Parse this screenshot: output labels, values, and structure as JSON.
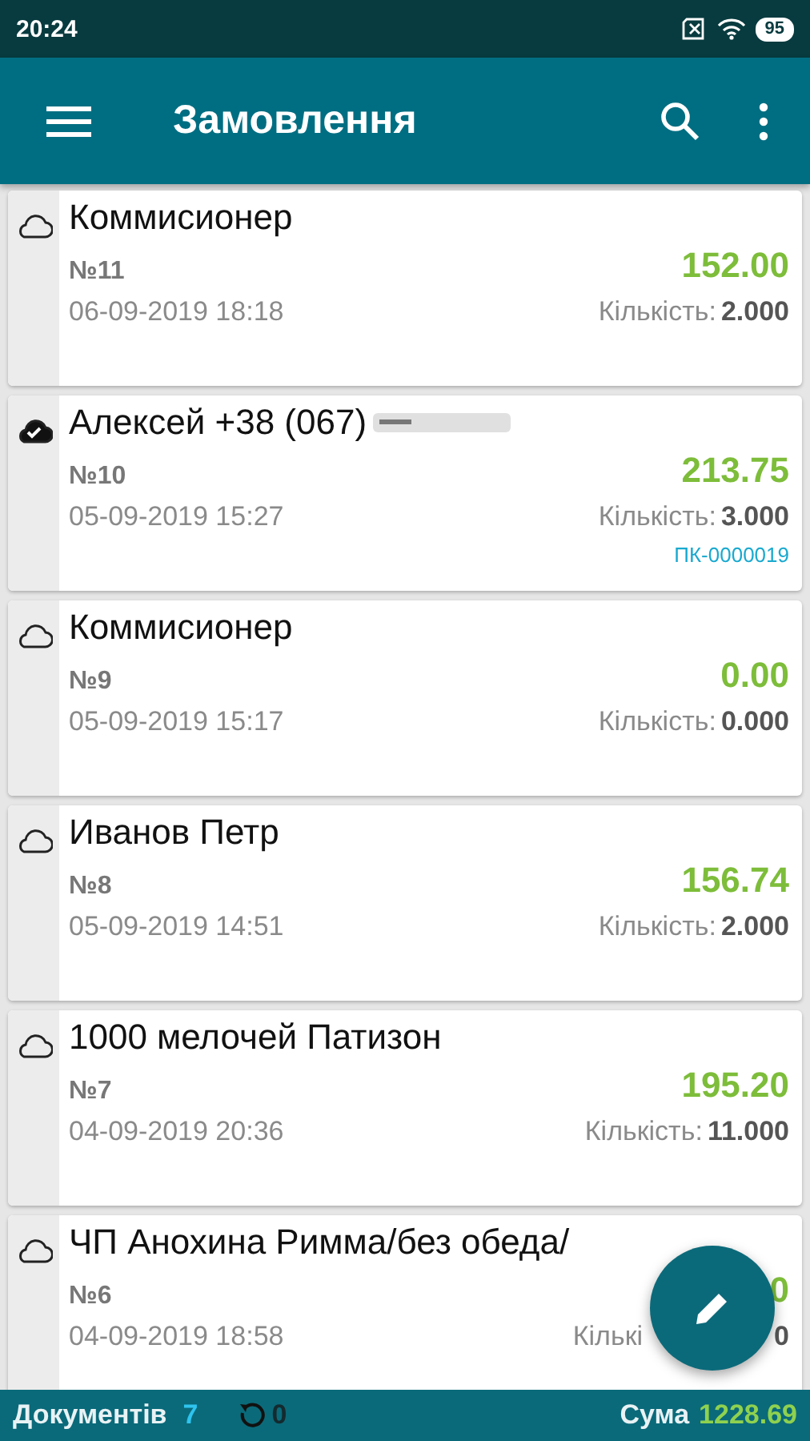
{
  "status_bar": {
    "time": "20:24",
    "battery": "95"
  },
  "app_bar": {
    "title": "Замовлення"
  },
  "orders": [
    {
      "name": "Коммисионер",
      "number": "№11",
      "date": "06-09-2019 18:18",
      "amount": "152.00",
      "quantity_label": "Кількість:",
      "quantity": "2.000",
      "synced": false,
      "redacted": false,
      "covered": false
    },
    {
      "name": "Алексей +38 (067)",
      "number": "№10",
      "date": "05-09-2019 15:27",
      "amount": "213.75",
      "quantity_label": "Кількість:",
      "quantity": "3.000",
      "synced": true,
      "redacted": true,
      "covered": false,
      "doc": "ПК-0000019"
    },
    {
      "name": "Коммисионер",
      "number": "№9",
      "date": "05-09-2019 15:17",
      "amount": "0.00",
      "quantity_label": "Кількість:",
      "quantity": "0.000",
      "synced": false,
      "redacted": false,
      "covered": false
    },
    {
      "name": "Иванов Петр",
      "number": "№8",
      "date": "05-09-2019 14:51",
      "amount": "156.74",
      "quantity_label": "Кількість:",
      "quantity": "2.000",
      "synced": false,
      "redacted": false,
      "covered": false
    },
    {
      "name": "1000 мелочей Патизон",
      "number": "№7",
      "date": "04-09-2019 20:36",
      "amount": "195.20",
      "quantity_label": "Кількість:",
      "quantity": "11.000",
      "synced": false,
      "redacted": false,
      "covered": false
    },
    {
      "name": "ЧП Анохина Римма/без обеда/",
      "number": "№6",
      "date": "04-09-2019 18:58",
      "amount": "0",
      "quantity_label": "Кількі",
      "quantity": "0",
      "synced": false,
      "redacted": false,
      "covered": true
    }
  ],
  "footer": {
    "documents_label": "Документів",
    "documents_count": "7",
    "pending_count": "0",
    "sum_label": "Сума",
    "sum": "1228.69"
  }
}
